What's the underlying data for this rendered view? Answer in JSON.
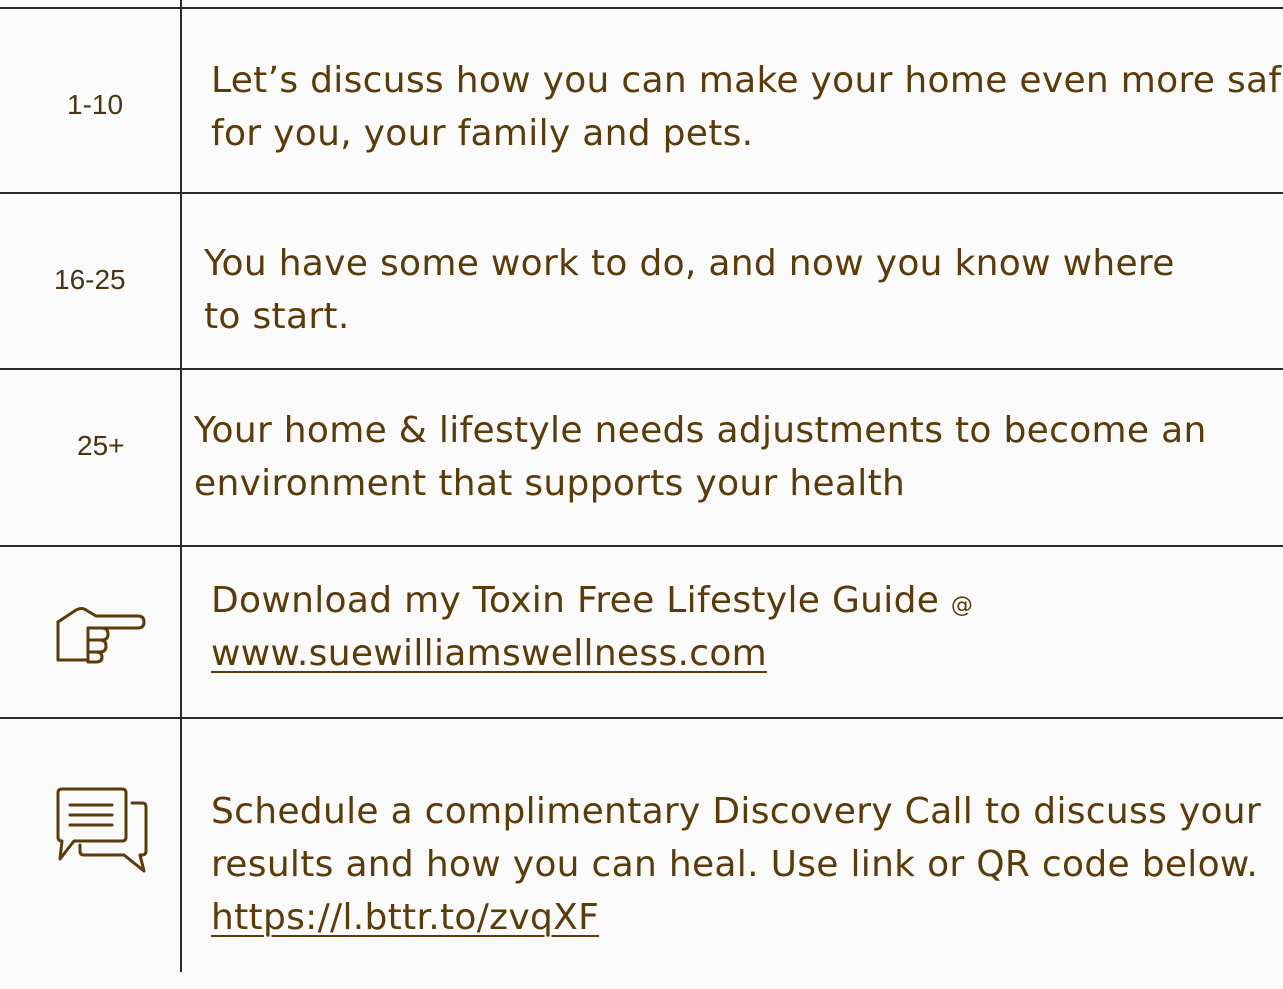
{
  "rows": [
    {
      "score": "1-10",
      "line1": "Let’s discuss how you can make your home even more safe",
      "line2": "for you, your family and pets."
    },
    {
      "score": "16-25",
      "line1": "You have some work to do, and now you know where",
      "line2": "to start."
    },
    {
      "score": "25+",
      "line1": "Your home & lifestyle needs adjustments to become an",
      "line2": "environment that supports your health"
    }
  ],
  "guide": {
    "icon": "pointing-hand-icon",
    "text": "Download my Toxin Free Lifestyle Guide",
    "at": "@",
    "link": "www.suewilliamswellness.com"
  },
  "call": {
    "icon": "chat-bubbles-icon",
    "line1": "Schedule a complimentary Discovery Call to discuss your",
    "line2": "results and how you can heal. Use link or QR code below.",
    "link": "https://l.bttr.to/zvqXF"
  },
  "colors": {
    "text": "#5b3b08",
    "border": "#2a2a2a",
    "background": "#fafafa"
  }
}
